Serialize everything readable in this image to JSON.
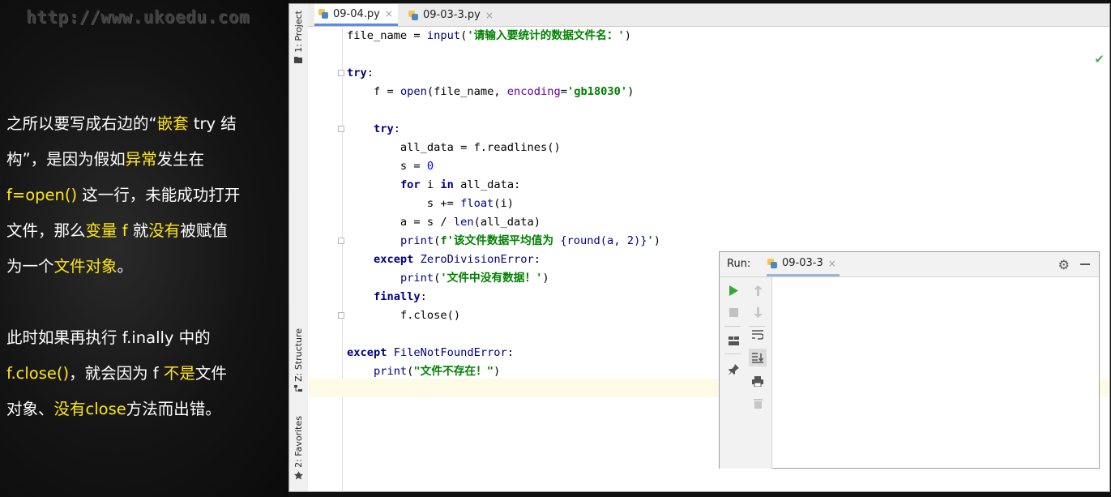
{
  "watermark": "http://www.ukoedu.com",
  "slide": {
    "para1": [
      {
        "t1": "之所以要写成右边的“",
        "h1": "嵌套",
        "t2": " try 结"
      },
      {
        "t1": "构”，是因为假如",
        "h1": "异常",
        "t2": "发生在"
      },
      {
        "h1": "f=open()",
        "t1": " 这一行，未能成功打开"
      },
      {
        "t1": "文件，那么",
        "h1": "变量 f",
        "t2": " 就",
        "h2": "没有",
        "t3": "被赋值"
      },
      {
        "t1": "为一个",
        "h1": "文件对象",
        "t2": "。"
      }
    ],
    "para2": [
      {
        "t1": "此时如果再执行 f.inally 中的"
      },
      {
        "h1": "f.close()",
        "t1": "，就会因为 f ",
        "h2": "不是",
        "t2": "文件"
      },
      {
        "t1": "对象、",
        "h1": "没有close",
        "t2": "方法而出错。"
      }
    ]
  },
  "ide": {
    "side_tabs": {
      "project": "1: Project",
      "structure": "Z: Structure",
      "favorites": "2: Favorites"
    },
    "file_tabs": [
      {
        "label": "09-04.py",
        "active": true
      },
      {
        "label": "09-03-3.py",
        "active": false
      }
    ],
    "close_glyph": "×",
    "check_glyph": "✔",
    "code": {
      "l0": {
        "a": "file_name = ",
        "b": "input",
        "c": "(",
        "d": "'请输入要统计的数据文件名：'",
        "e": ")"
      },
      "l2": {
        "a": "try",
        "b": ":"
      },
      "l3": {
        "a": "    f = ",
        "b": "open",
        "c": "(file_name, ",
        "d": "encoding",
        "e": "=",
        "f": "'gb18030'",
        "g": ")"
      },
      "l5": {
        "a": "    ",
        "b": "try",
        "c": ":"
      },
      "l6": {
        "a": "        all_data = f.readlines()"
      },
      "l7": {
        "a": "        s = ",
        "b": "0"
      },
      "l8": {
        "a": "        ",
        "b": "for",
        "c": " i ",
        "d": "in",
        "e": " all_data:"
      },
      "l9": {
        "a": "            s += ",
        "b": "float",
        "c": "(i)"
      },
      "l10": {
        "a": "        a = s / ",
        "b": "len",
        "c": "(all_data)"
      },
      "l11": {
        "a": "        ",
        "b": "print",
        "c": "(",
        "d": "f'该文件数据平均值为 ",
        "e": "{round(a, 2)}",
        "f": "'",
        "g": ")"
      },
      "l12": {
        "a": "    ",
        "b": "except",
        "c": " ",
        "d": "ZeroDivisionError",
        "e": ":"
      },
      "l13": {
        "a": "        ",
        "b": "print",
        "c": "(",
        "d": "'文件中没有数据！'",
        "e": ")"
      },
      "l14": {
        "a": "    ",
        "b": "finally",
        "c": ":"
      },
      "l15": {
        "a": "        f.close()"
      },
      "l17": {
        "a": "except",
        "b": " ",
        "c": "FileNotFoundError",
        "d": ":"
      },
      "l18": {
        "a": "    ",
        "b": "print",
        "c": "(",
        "d": "\"文件不存在！\"",
        "e": ")"
      }
    }
  },
  "run_panel": {
    "label": "Run:",
    "tab": "09-03-3",
    "close_glyph": "×",
    "gear_glyph": "⚙"
  },
  "colors": {
    "highlight": "#ffe814",
    "keyword": "#000080",
    "string": "#008000",
    "number": "#0000ff",
    "kwarg": "#660099",
    "run_green": "#35a835"
  }
}
